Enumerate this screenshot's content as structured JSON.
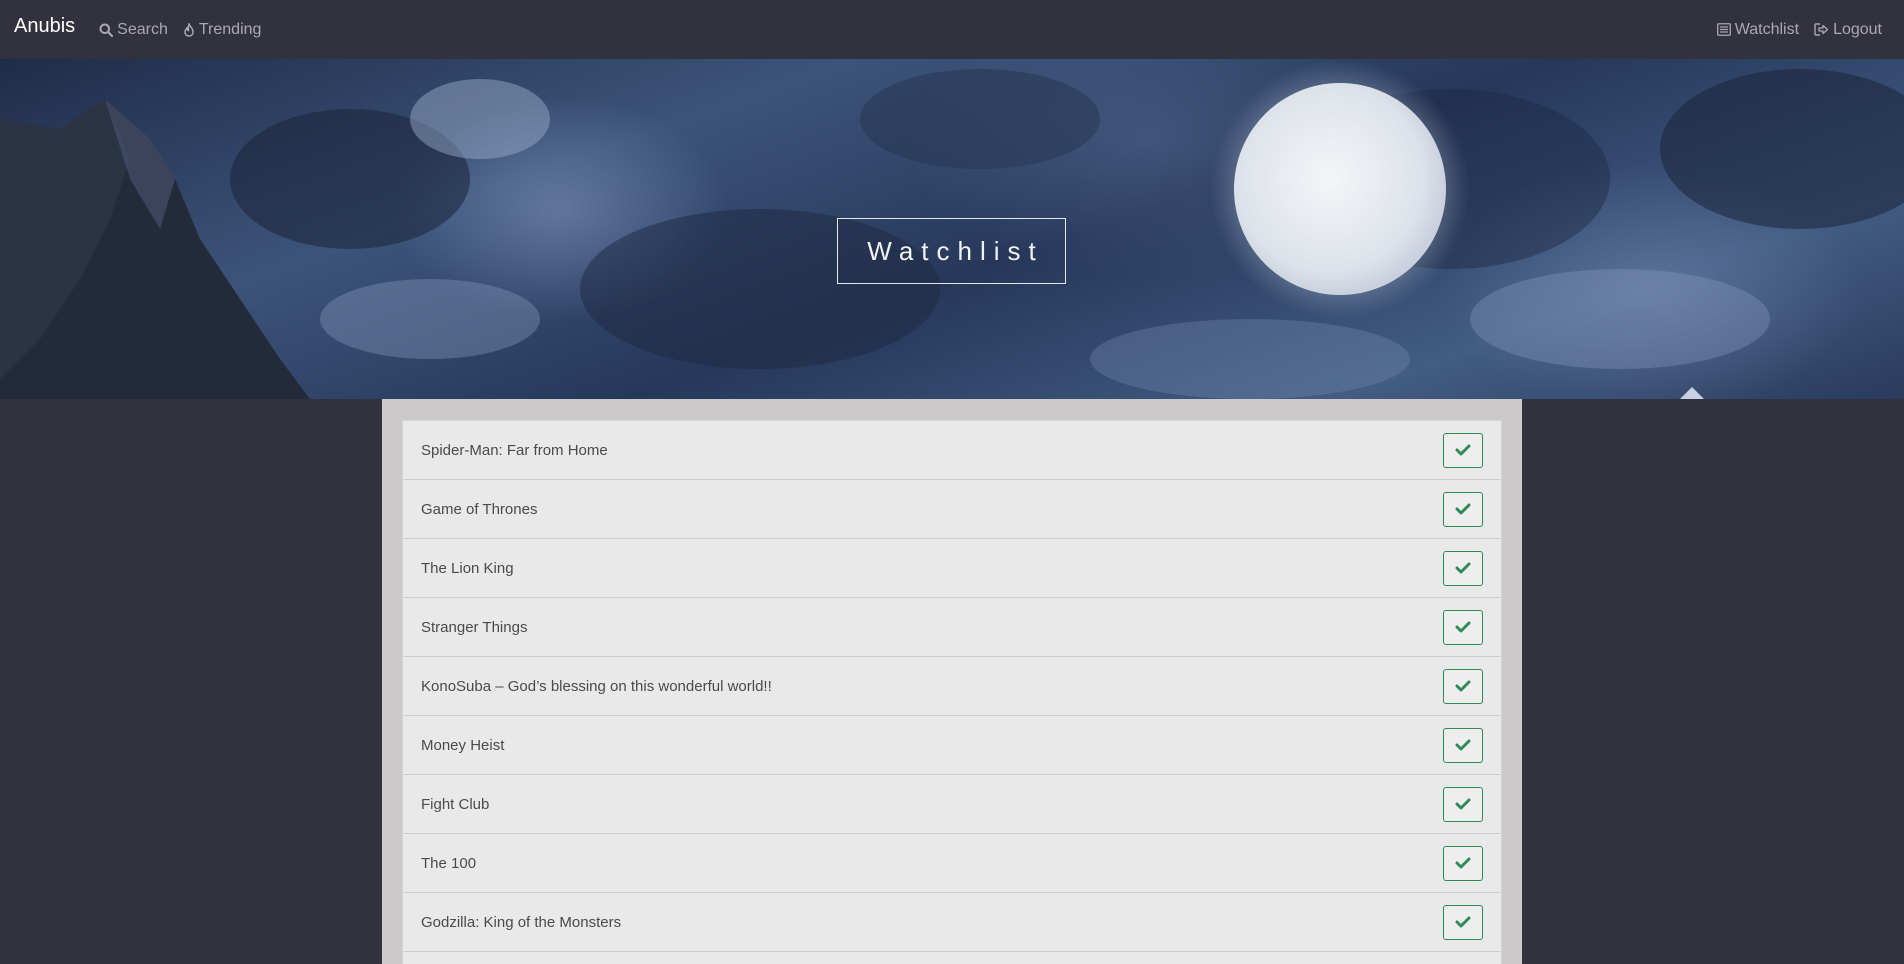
{
  "navbar": {
    "brand": "Anubis",
    "links_left": [
      {
        "label": "Search",
        "icon": "search-icon"
      },
      {
        "label": "Trending",
        "icon": "fire-icon"
      }
    ],
    "links_right": [
      {
        "label": "Watchlist",
        "icon": "list-icon"
      },
      {
        "label": "Logout",
        "icon": "logout-icon"
      }
    ]
  },
  "hero": {
    "title": "Watchlist"
  },
  "watchlist": {
    "items": [
      {
        "title": "Spider-Man: Far from Home",
        "status": "watched"
      },
      {
        "title": "Game of Thrones",
        "status": "watched"
      },
      {
        "title": "The Lion King",
        "status": "watched"
      },
      {
        "title": "Stranger Things",
        "status": "watched"
      },
      {
        "title": "KonoSuba – God’s blessing on this wonderful world!!",
        "status": "watched"
      },
      {
        "title": "Money Heist",
        "status": "watched"
      },
      {
        "title": "Fight Club",
        "status": "watched"
      },
      {
        "title": "The 100",
        "status": "watched"
      },
      {
        "title": "Godzilla: King of the Monsters",
        "status": "watched"
      },
      {
        "title": "",
        "status": "pending"
      }
    ]
  },
  "colors": {
    "background": "#32313e",
    "panel": "#cbc9c9",
    "list_bg": "#e9e9e9",
    "check_green": "#2e8b57",
    "pending_orange": "#d4a43a"
  }
}
